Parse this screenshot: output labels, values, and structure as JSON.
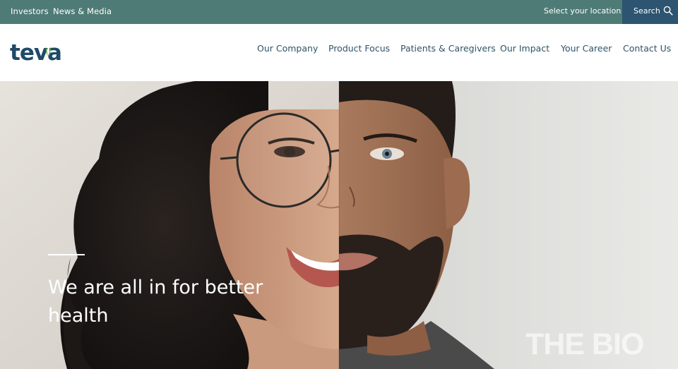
{
  "topbar": {
    "investors": "Investors",
    "news_media": "News & Media",
    "location": "Select your location",
    "search_label": "Search"
  },
  "logo": {
    "text": "teva"
  },
  "nav": {
    "our_company": "Our Company",
    "product_focus": "Product Focus",
    "patients": "Patients & Caregivers",
    "impact": "Our Impact",
    "career": "Your Career",
    "contact": "Contact Us"
  },
  "hero": {
    "headline": "We are all in for better health"
  },
  "watermark": {
    "text": "THE BIO"
  },
  "colors": {
    "topbar_bg": "#4f7b76",
    "search_bg": "#2d5470",
    "nav_text": "#2e5468",
    "logo_green": "#6cb33f",
    "logo_blue": "#1f4a68"
  }
}
